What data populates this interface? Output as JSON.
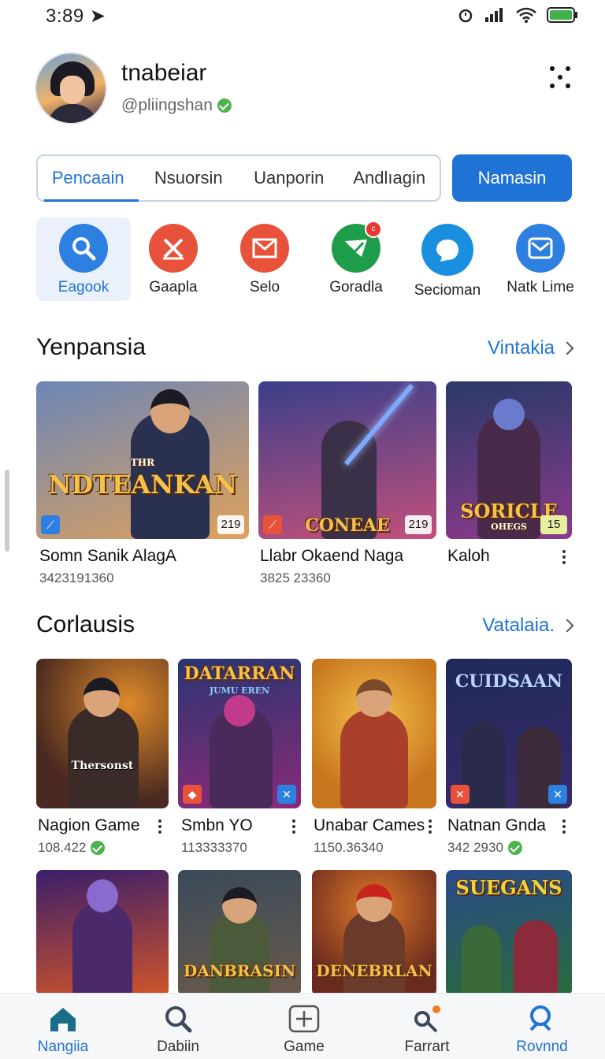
{
  "status_bar": {
    "time": "3:89"
  },
  "profile": {
    "name": "tnabeiar",
    "handle": "@pliingshan"
  },
  "tabs": [
    "Pencaain",
    "Nsuorsin",
    "Uanporin",
    "Andlıagin"
  ],
  "primary_button": "Namasin",
  "categories": [
    {
      "label": "Eagook",
      "icon": "search-icon",
      "color": "#2d7fe0"
    },
    {
      "label": "Gaapla",
      "icon": "cross-icon",
      "color": "#e8513a"
    },
    {
      "label": "Selo",
      "icon": "mail-icon",
      "color": "#e8513a"
    },
    {
      "label": "Goradla",
      "icon": "check-icon",
      "color": "#1e9e4a",
      "badge": "c"
    },
    {
      "label": "Secioman",
      "icon": "chat-icon",
      "color": "#1a8fe0"
    },
    {
      "label": "Natk Lime",
      "icon": "envelope-icon",
      "color": "#2d7fe0"
    }
  ],
  "section1": {
    "title": "Yenpansia",
    "link": "Vintakia",
    "items": [
      {
        "name": "Somn Sanik AlagA",
        "meta": "3423191360",
        "art_title": "NDTEANKAN",
        "art_subtitle": "THR",
        "badge": "219",
        "bg1": "#6b86b8",
        "bg2": "#e0a15a"
      },
      {
        "name": "Llabr Okaend Naga",
        "meta": "3825 23360",
        "art_title": "CONEAE",
        "badge": "219",
        "bg1": "#3a3f8a",
        "bg2": "#c2507a"
      },
      {
        "name": "Kaloh",
        "meta": "",
        "art_title": "SORICLE",
        "art_subtitle": "OHEGS",
        "badge": "15",
        "bg1": "#2a3a6a",
        "bg2": "#8a3a8a"
      }
    ]
  },
  "section2": {
    "title": "Corlausis",
    "link": "Vatalaia.",
    "items": [
      {
        "name": "Nagion Game",
        "meta": "108.422",
        "verified": true,
        "art_title": "Thersonst",
        "bg1": "#4a2a20",
        "bg2": "#c8621e"
      },
      {
        "name": "Smbn YO",
        "meta": "113333370",
        "verified": false,
        "art_title": "DATARRAN",
        "art_subtitle": "JUMU EREN",
        "bg1": "#2a3570",
        "bg2": "#8a2a7a"
      },
      {
        "name": "Unabar Cames",
        "meta": "1150.36340",
        "verified": false,
        "art_title": "",
        "bg1": "#c8761e",
        "bg2": "#f4c24a"
      },
      {
        "name": "Natnan Gnda",
        "meta": "342 2930",
        "verified": true,
        "art_title": "CUIDSAAN",
        "bg1": "#1e2a5a",
        "bg2": "#3a2a6a"
      }
    ],
    "row2": [
      {
        "art_title": "",
        "bg1": "#3a1e6a",
        "bg2": "#d0542a"
      },
      {
        "art_title": "DANBRASIN",
        "bg1": "#3a4a5a",
        "bg2": "#6a5a4a"
      },
      {
        "art_title": "DENEBRLAN",
        "bg1": "#6a2a1e",
        "bg2": "#e07a2a"
      },
      {
        "art_title": "SUEGANS",
        "bg1": "#2a4a8a",
        "bg2": "#2a6a3a"
      }
    ]
  },
  "bottom_nav": [
    {
      "label": "Nangiia",
      "icon": "home-icon"
    },
    {
      "label": "Dabiin",
      "icon": "search-icon"
    },
    {
      "label": "Game",
      "icon": "add-box-icon"
    },
    {
      "label": "Farrart",
      "icon": "key-icon"
    },
    {
      "label": "Rovnnd",
      "icon": "profile-search-icon"
    }
  ]
}
